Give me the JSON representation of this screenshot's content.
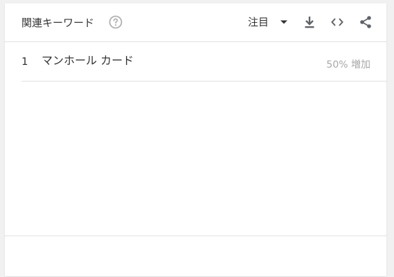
{
  "widget": {
    "title": "関連キーワード",
    "help_icon": "help-circle-icon",
    "sort": {
      "selected": "注目"
    },
    "toolbar_icons": [
      "download-icon",
      "embed-code-icon",
      "share-icon"
    ]
  },
  "rows": [
    {
      "rank": "1",
      "query": "マンホール カード",
      "value": "50% 増加"
    }
  ],
  "colors": {
    "text": "#333333",
    "muted": "#a8a8a8",
    "icon": "#5f6368",
    "divider": "#e0e0e0"
  }
}
